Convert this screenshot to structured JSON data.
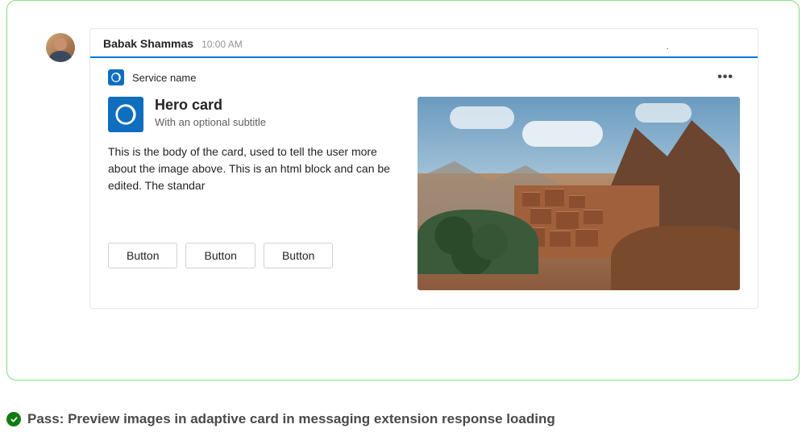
{
  "message": {
    "sender": "Babak Shammas",
    "timestamp": "10:00 AM"
  },
  "card": {
    "service_name": "Service name",
    "title": "Hero card",
    "subtitle": "With an optional subtitle",
    "body": "This is the body of the card, used to tell the user more about the image above. This is an html block and can be edited. The standar",
    "buttons": [
      "Button",
      "Button",
      "Button"
    ],
    "image_alt": "Adobe village on hillside with mountains"
  },
  "validation": {
    "status_prefix": "Pass:",
    "message": " Preview images in adaptive card in messaging extension response loading"
  },
  "colors": {
    "accent": "#0078d4",
    "success": "#107c10",
    "border_success": "#7fe07f"
  }
}
